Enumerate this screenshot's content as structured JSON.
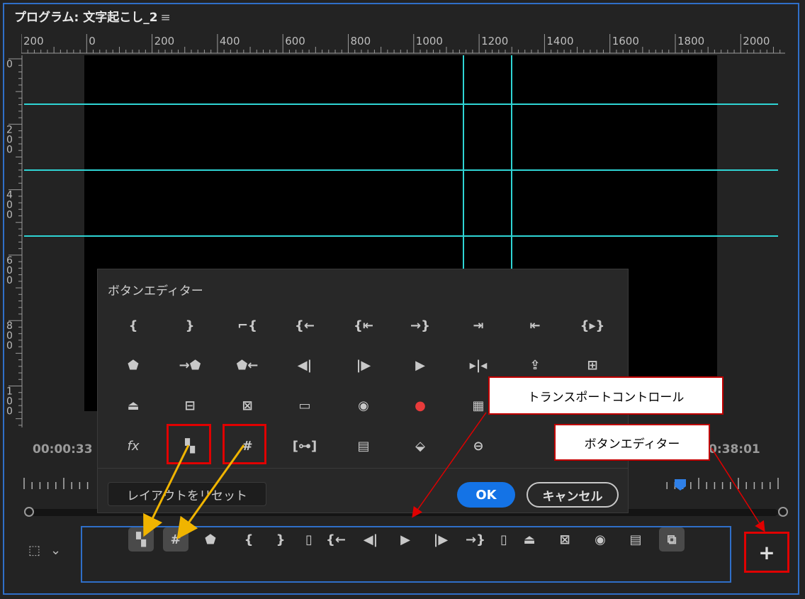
{
  "window": {
    "title": "プログラム: 文字起こし_2",
    "menu_icon": "≡"
  },
  "ruler": {
    "h_labels": [
      "200",
      "0",
      "200",
      "400",
      "600",
      "800",
      "1000",
      "1200",
      "1400",
      "1600",
      "1800",
      "2000"
    ],
    "v_labels": [
      "0",
      "2\n0\n0",
      "4\n0\n0",
      "6\n0\n0",
      "8\n0\n0",
      "1\n0\n0"
    ]
  },
  "timecode": {
    "left": "00:00:33",
    "right": "0:38:01"
  },
  "button_editor": {
    "title": "ボタンエディター",
    "rows": [
      [
        "mark-in-icon",
        "mark-out-icon",
        "mark-clip-icon",
        "go-to-in-icon",
        "go-to-in-jump-icon",
        "go-to-out-jump-icon",
        "go-to-next-icon",
        "go-to-previous-icon",
        "play-in-to-out-icon"
      ],
      [
        "add-marker-icon",
        "go-to-next-marker-icon",
        "go-to-previous-marker-icon",
        "step-back-icon",
        "step-forward-icon",
        "play-icon",
        "trim-icon",
        "export-icon",
        "insert-icon"
      ],
      [
        "lift-icon",
        "overwrite-icon",
        "extract-icon",
        "safe-margins-icon",
        "camera-icon",
        "record-icon",
        "multicam-icon"
      ],
      [
        "fx-icon",
        "comparison-view-icon",
        "guides-icon",
        "vr-icon",
        "proxy-icon",
        "snap-icon",
        "closed-caption-icon"
      ]
    ],
    "reset_label": "レイアウトをリセット",
    "ok_label": "OK",
    "cancel_label": "キャンセル"
  },
  "callouts": {
    "transport": "トランスポートコントロール",
    "editor": "ボタンエディター"
  },
  "transport": {
    "buttons": [
      "comparison-view-icon",
      "guides-icon",
      "add-marker-icon",
      "mark-in-icon",
      "mark-out-icon",
      "divider",
      "go-to-in-icon",
      "step-back-icon",
      "play-icon",
      "step-forward-icon",
      "go-to-out-icon",
      "divider",
      "lift-icon",
      "extract-icon",
      "camera-icon",
      "proxy-icon",
      "multicam-toggle-icon"
    ],
    "plus_label": "+"
  },
  "colors": {
    "accent": "#1473e6",
    "panel_border": "#2f6fc8",
    "annotation_red": "#e00000",
    "arrow_yellow": "#f0b400",
    "guide": "#2fd4d4",
    "record": "#e83b3b"
  }
}
